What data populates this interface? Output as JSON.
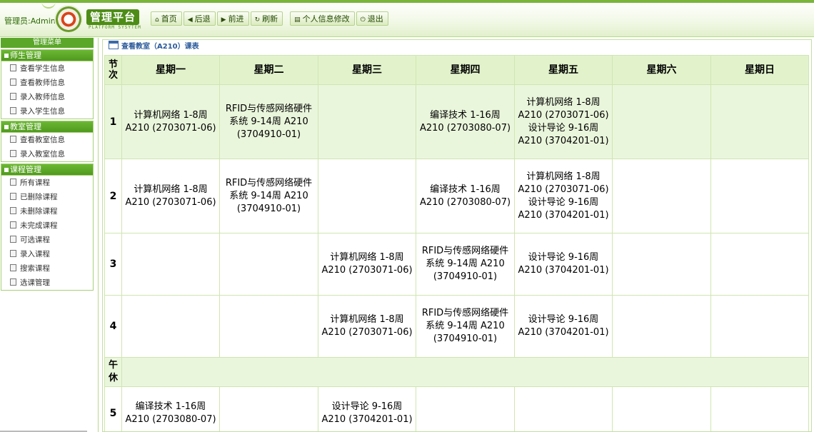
{
  "header": {
    "admin_label": "管理员:Admin",
    "logo_title": "管理平台",
    "logo_subtitle": "PLATFORM SYSYTEM",
    "nav": [
      {
        "icon": "home-icon",
        "glyph": "⌂",
        "label": "首页"
      },
      {
        "icon": "back-icon",
        "glyph": "◀",
        "label": "后退"
      },
      {
        "icon": "forward-icon",
        "glyph": "▶",
        "label": "前进"
      },
      {
        "icon": "refresh-icon",
        "glyph": "↻",
        "label": "刷新"
      },
      {
        "icon": "profile-edit-icon",
        "glyph": "▤",
        "label": "个人信息修改"
      },
      {
        "icon": "power-icon",
        "glyph": "⏻",
        "label": "退出"
      }
    ]
  },
  "sidebar": {
    "title": "管理菜单",
    "groups": [
      {
        "title": "师生管理",
        "items": [
          "查看学生信息",
          "查看教师信息",
          "录入教师信息",
          "录入学生信息"
        ]
      },
      {
        "title": "教室管理",
        "items": [
          "查看教室信息",
          "录入教室信息"
        ]
      },
      {
        "title": "课程管理",
        "items": [
          "所有课程",
          "已删除课程",
          "未删除课程",
          "未完成课程",
          "可选课程",
          "录入课程",
          "搜索课程",
          "选课管理"
        ]
      }
    ]
  },
  "main": {
    "breadcrumb": "查看教室（A210）课表",
    "table": {
      "corner": "节次",
      "days": [
        "星期一",
        "星期二",
        "星期三",
        "星期四",
        "星期五",
        "星期六",
        "星期日"
      ],
      "lunch_label": "午休",
      "rows": [
        {
          "num": "1",
          "cells": [
            "计算机网络 1-8周 A210 (2703071-06)",
            "RFID与传感网络硬件系统 9-14周 A210 (3704910-01)",
            "",
            "编译技术 1-16周 A210 (2703080-07)",
            "计算机网络 1-8周 A210 (2703071-06) 设计导论 9-16周 A210 (3704201-01)",
            "",
            ""
          ]
        },
        {
          "num": "2",
          "cells": [
            "计算机网络 1-8周 A210 (2703071-06)",
            "RFID与传感网络硬件系统 9-14周 A210 (3704910-01)",
            "",
            "编译技术 1-16周 A210 (2703080-07)",
            "计算机网络 1-8周 A210 (2703071-06) 设计导论 9-16周 A210 (3704201-01)",
            "",
            ""
          ]
        },
        {
          "num": "3",
          "cells": [
            "",
            "",
            "计算机网络 1-8周 A210 (2703071-06)",
            "RFID与传感网络硬件系统 9-14周 A210 (3704910-01)",
            "设计导论 9-16周 A210 (3704201-01)",
            "",
            ""
          ]
        },
        {
          "num": "4",
          "cells": [
            "",
            "",
            "计算机网络 1-8周 A210 (2703071-06)",
            "RFID与传感网络硬件系统 9-14周 A210 (3704910-01)",
            "设计导论 9-16周 A210 (3704201-01)",
            "",
            ""
          ]
        },
        {
          "num": "5",
          "cells": [
            "编译技术 1-16周 A210 (2703080-07)",
            "",
            "设计导论 9-16周 A210 (3704201-01)",
            "",
            "",
            "",
            ""
          ]
        }
      ]
    }
  }
}
